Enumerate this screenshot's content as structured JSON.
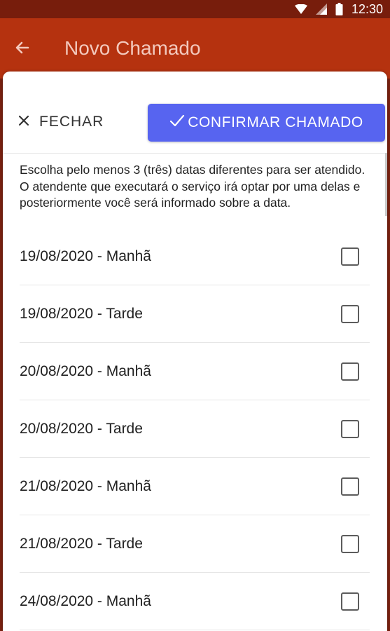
{
  "status_bar": {
    "time": "12:30",
    "icons": [
      "wifi-icon",
      "signal-icon",
      "battery-icon"
    ]
  },
  "app_bar": {
    "back_icon": "arrow-left-icon",
    "title": "Novo Chamado"
  },
  "sheet": {
    "close_label": "FECHAR",
    "close_icon": "close-icon",
    "confirm_label": "CONFIRMAR CHAMADO",
    "confirm_icon": "check-icon",
    "instructions": "Escolha pelo menos 3 (três) datas diferentes para ser atendido. O atendente que executará o serviço irá optar por uma delas e posteriormente você será informado sobre a data.",
    "options": [
      {
        "label": "19/08/2020 - Manhã",
        "checked": false
      },
      {
        "label": "19/08/2020 - Tarde",
        "checked": false
      },
      {
        "label": "20/08/2020 - Manhã",
        "checked": false
      },
      {
        "label": "20/08/2020 - Tarde",
        "checked": false
      },
      {
        "label": "21/08/2020 - Manhã",
        "checked": false
      },
      {
        "label": "21/08/2020 - Tarde",
        "checked": false
      },
      {
        "label": "24/08/2020 - Manhã",
        "checked": false
      }
    ]
  },
  "colors": {
    "status_bar": "#771d0c",
    "app_bar": "#b5320f",
    "confirm_button": "#5764f0",
    "title_text": "#f3c9bd"
  }
}
